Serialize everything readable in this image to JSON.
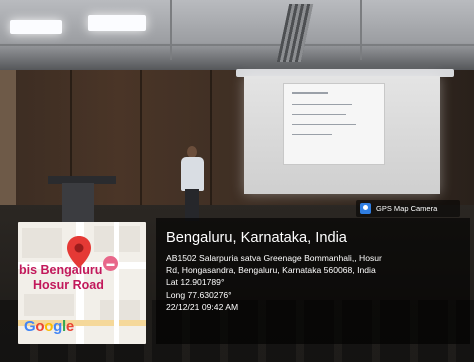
{
  "badge": {
    "label": "GPS Map Camera",
    "icon": "gps-map-camera-icon"
  },
  "location": {
    "city": "Bengaluru, Karnataka, India",
    "address_line1": "AB1502 Salarpuria satva Greenage Bommanhali,, Hosur",
    "address_line2": "Rd, Hongasandra, Bengaluru, Karnataka 560068, India",
    "lat": "Lat 12.901789°",
    "long": "Long 77.630276°",
    "datetime": "22/12/21 09:42 AM"
  },
  "map": {
    "label_line1": "bis Bengaluru",
    "label_line2": "Hosur Road",
    "pin_color": "#e53935",
    "label_color": "#c2185b",
    "google_letters": [
      "G",
      "o",
      "o",
      "g",
      "l",
      "e"
    ]
  },
  "colors": {
    "overlay": "#000000",
    "text": "#ffffff"
  }
}
